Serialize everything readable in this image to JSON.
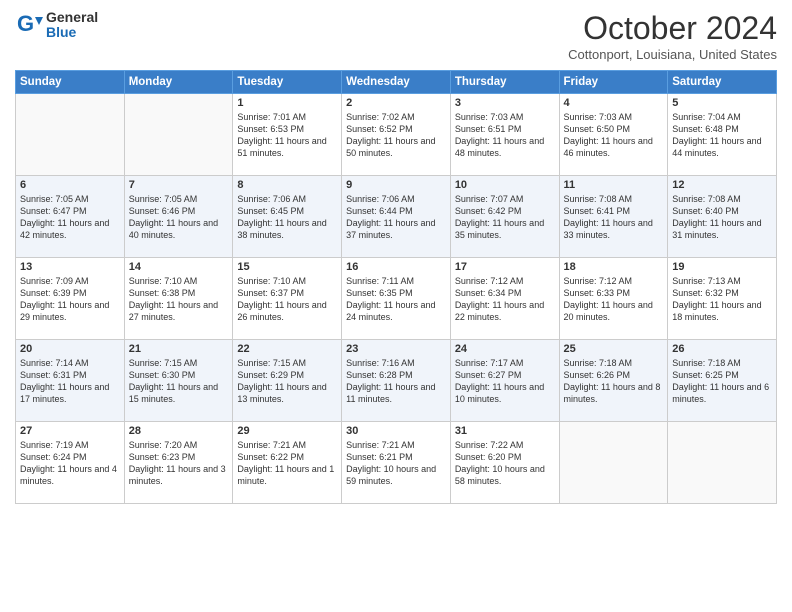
{
  "logo": {
    "general": "General",
    "blue": "Blue"
  },
  "title": "October 2024",
  "location": "Cottonport, Louisiana, United States",
  "days_of_week": [
    "Sunday",
    "Monday",
    "Tuesday",
    "Wednesday",
    "Thursday",
    "Friday",
    "Saturday"
  ],
  "weeks": [
    [
      {
        "day": "",
        "empty": true
      },
      {
        "day": "",
        "empty": true
      },
      {
        "day": "1",
        "sunrise": "Sunrise: 7:01 AM",
        "sunset": "Sunset: 6:53 PM",
        "daylight": "Daylight: 11 hours and 51 minutes."
      },
      {
        "day": "2",
        "sunrise": "Sunrise: 7:02 AM",
        "sunset": "Sunset: 6:52 PM",
        "daylight": "Daylight: 11 hours and 50 minutes."
      },
      {
        "day": "3",
        "sunrise": "Sunrise: 7:03 AM",
        "sunset": "Sunset: 6:51 PM",
        "daylight": "Daylight: 11 hours and 48 minutes."
      },
      {
        "day": "4",
        "sunrise": "Sunrise: 7:03 AM",
        "sunset": "Sunset: 6:50 PM",
        "daylight": "Daylight: 11 hours and 46 minutes."
      },
      {
        "day": "5",
        "sunrise": "Sunrise: 7:04 AM",
        "sunset": "Sunset: 6:48 PM",
        "daylight": "Daylight: 11 hours and 44 minutes."
      }
    ],
    [
      {
        "day": "6",
        "sunrise": "Sunrise: 7:05 AM",
        "sunset": "Sunset: 6:47 PM",
        "daylight": "Daylight: 11 hours and 42 minutes."
      },
      {
        "day": "7",
        "sunrise": "Sunrise: 7:05 AM",
        "sunset": "Sunset: 6:46 PM",
        "daylight": "Daylight: 11 hours and 40 minutes."
      },
      {
        "day": "8",
        "sunrise": "Sunrise: 7:06 AM",
        "sunset": "Sunset: 6:45 PM",
        "daylight": "Daylight: 11 hours and 38 minutes."
      },
      {
        "day": "9",
        "sunrise": "Sunrise: 7:06 AM",
        "sunset": "Sunset: 6:44 PM",
        "daylight": "Daylight: 11 hours and 37 minutes."
      },
      {
        "day": "10",
        "sunrise": "Sunrise: 7:07 AM",
        "sunset": "Sunset: 6:42 PM",
        "daylight": "Daylight: 11 hours and 35 minutes."
      },
      {
        "day": "11",
        "sunrise": "Sunrise: 7:08 AM",
        "sunset": "Sunset: 6:41 PM",
        "daylight": "Daylight: 11 hours and 33 minutes."
      },
      {
        "day": "12",
        "sunrise": "Sunrise: 7:08 AM",
        "sunset": "Sunset: 6:40 PM",
        "daylight": "Daylight: 11 hours and 31 minutes."
      }
    ],
    [
      {
        "day": "13",
        "sunrise": "Sunrise: 7:09 AM",
        "sunset": "Sunset: 6:39 PM",
        "daylight": "Daylight: 11 hours and 29 minutes."
      },
      {
        "day": "14",
        "sunrise": "Sunrise: 7:10 AM",
        "sunset": "Sunset: 6:38 PM",
        "daylight": "Daylight: 11 hours and 27 minutes."
      },
      {
        "day": "15",
        "sunrise": "Sunrise: 7:10 AM",
        "sunset": "Sunset: 6:37 PM",
        "daylight": "Daylight: 11 hours and 26 minutes."
      },
      {
        "day": "16",
        "sunrise": "Sunrise: 7:11 AM",
        "sunset": "Sunset: 6:35 PM",
        "daylight": "Daylight: 11 hours and 24 minutes."
      },
      {
        "day": "17",
        "sunrise": "Sunrise: 7:12 AM",
        "sunset": "Sunset: 6:34 PM",
        "daylight": "Daylight: 11 hours and 22 minutes."
      },
      {
        "day": "18",
        "sunrise": "Sunrise: 7:12 AM",
        "sunset": "Sunset: 6:33 PM",
        "daylight": "Daylight: 11 hours and 20 minutes."
      },
      {
        "day": "19",
        "sunrise": "Sunrise: 7:13 AM",
        "sunset": "Sunset: 6:32 PM",
        "daylight": "Daylight: 11 hours and 18 minutes."
      }
    ],
    [
      {
        "day": "20",
        "sunrise": "Sunrise: 7:14 AM",
        "sunset": "Sunset: 6:31 PM",
        "daylight": "Daylight: 11 hours and 17 minutes."
      },
      {
        "day": "21",
        "sunrise": "Sunrise: 7:15 AM",
        "sunset": "Sunset: 6:30 PM",
        "daylight": "Daylight: 11 hours and 15 minutes."
      },
      {
        "day": "22",
        "sunrise": "Sunrise: 7:15 AM",
        "sunset": "Sunset: 6:29 PM",
        "daylight": "Daylight: 11 hours and 13 minutes."
      },
      {
        "day": "23",
        "sunrise": "Sunrise: 7:16 AM",
        "sunset": "Sunset: 6:28 PM",
        "daylight": "Daylight: 11 hours and 11 minutes."
      },
      {
        "day": "24",
        "sunrise": "Sunrise: 7:17 AM",
        "sunset": "Sunset: 6:27 PM",
        "daylight": "Daylight: 11 hours and 10 minutes."
      },
      {
        "day": "25",
        "sunrise": "Sunrise: 7:18 AM",
        "sunset": "Sunset: 6:26 PM",
        "daylight": "Daylight: 11 hours and 8 minutes."
      },
      {
        "day": "26",
        "sunrise": "Sunrise: 7:18 AM",
        "sunset": "Sunset: 6:25 PM",
        "daylight": "Daylight: 11 hours and 6 minutes."
      }
    ],
    [
      {
        "day": "27",
        "sunrise": "Sunrise: 7:19 AM",
        "sunset": "Sunset: 6:24 PM",
        "daylight": "Daylight: 11 hours and 4 minutes."
      },
      {
        "day": "28",
        "sunrise": "Sunrise: 7:20 AM",
        "sunset": "Sunset: 6:23 PM",
        "daylight": "Daylight: 11 hours and 3 minutes."
      },
      {
        "day": "29",
        "sunrise": "Sunrise: 7:21 AM",
        "sunset": "Sunset: 6:22 PM",
        "daylight": "Daylight: 11 hours and 1 minute."
      },
      {
        "day": "30",
        "sunrise": "Sunrise: 7:21 AM",
        "sunset": "Sunset: 6:21 PM",
        "daylight": "Daylight: 10 hours and 59 minutes."
      },
      {
        "day": "31",
        "sunrise": "Sunrise: 7:22 AM",
        "sunset": "Sunset: 6:20 PM",
        "daylight": "Daylight: 10 hours and 58 minutes."
      },
      {
        "day": "",
        "empty": true
      },
      {
        "day": "",
        "empty": true
      }
    ]
  ]
}
